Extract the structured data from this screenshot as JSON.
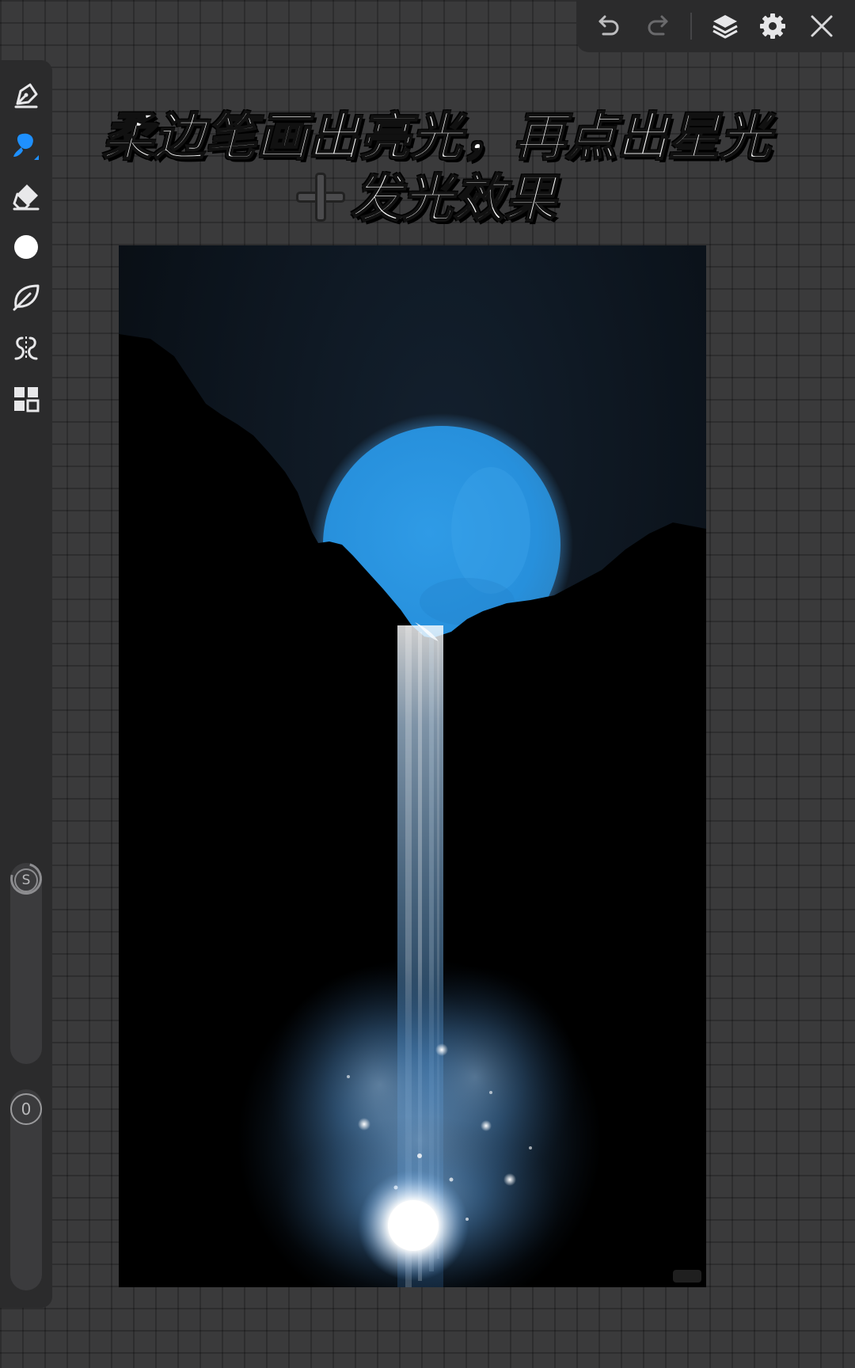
{
  "caption": {
    "line1": "柔边笔画出亮光，再点出星光",
    "line2": "发光效果"
  },
  "toolbar": {
    "items": [
      {
        "name": "undo-icon"
      },
      {
        "name": "redo-icon"
      },
      {
        "name": "layers-icon"
      },
      {
        "name": "settings-icon"
      },
      {
        "name": "close-icon"
      }
    ]
  },
  "tools": [
    {
      "name": "pen-icon"
    },
    {
      "name": "brush-icon",
      "selected": true
    },
    {
      "name": "eraser-icon"
    },
    {
      "name": "color-icon"
    },
    {
      "name": "leaf-icon"
    },
    {
      "name": "symmetry-icon"
    },
    {
      "name": "grid-icon"
    }
  ],
  "sliders": {
    "size_label": "S",
    "opacity_label": "0"
  },
  "colors": {
    "accent": "#1e90ff",
    "moon": "#2b93e0",
    "panel": "#2b2b2c",
    "background": "#3a3a3b"
  }
}
